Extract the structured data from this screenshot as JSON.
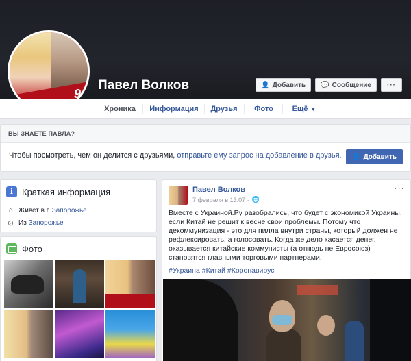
{
  "profile": {
    "name": "Павел Волков",
    "add_friend_label": "Добавить",
    "message_label": "Сообщение",
    "more_label": "···",
    "avatar_number": "9"
  },
  "tabs": [
    {
      "label": "Хроника",
      "active": true
    },
    {
      "label": "Информация"
    },
    {
      "label": "Друзья"
    },
    {
      "label": "Фото"
    },
    {
      "label": "Ещё"
    }
  ],
  "know": {
    "title": "ВЫ ЗНАЕТЕ ПАВЛА?",
    "text_prefix": "Чтобы посмотреть, чем он делится с друзьями, ",
    "link_text": "отправьте ему запрос на добавление в друзья.",
    "button_label": "Добавить"
  },
  "intro": {
    "title": "Краткая информация",
    "lives_prefix": "Живет в г. ",
    "lives_city": "Запорожье",
    "from_prefix": "Из ",
    "from_city": "Запорожье"
  },
  "photos": {
    "title": "Фото"
  },
  "post": {
    "author": "Павел Волков",
    "date": "7 февраля в 13:07 ·",
    "more": "···",
    "text": "Вместе с Украиной.Ру разобрались, что будет с экономикой Украины, если Китай не решит к весне свои проблемы. Потому что декоммунизация - это для пилла внутри страны, который должен не рефлексировать, а голосовать. Когда же дело касается денег, оказывается китайские коммунисты (а отнюдь не Евросоюз) становятся главными торговыми партнерами.",
    "tags": "#Украина #Китай #Коронавирус"
  },
  "colors": {
    "link": "#365899",
    "primary_button": "#4267b2",
    "page_bg": "#e9ebee"
  }
}
